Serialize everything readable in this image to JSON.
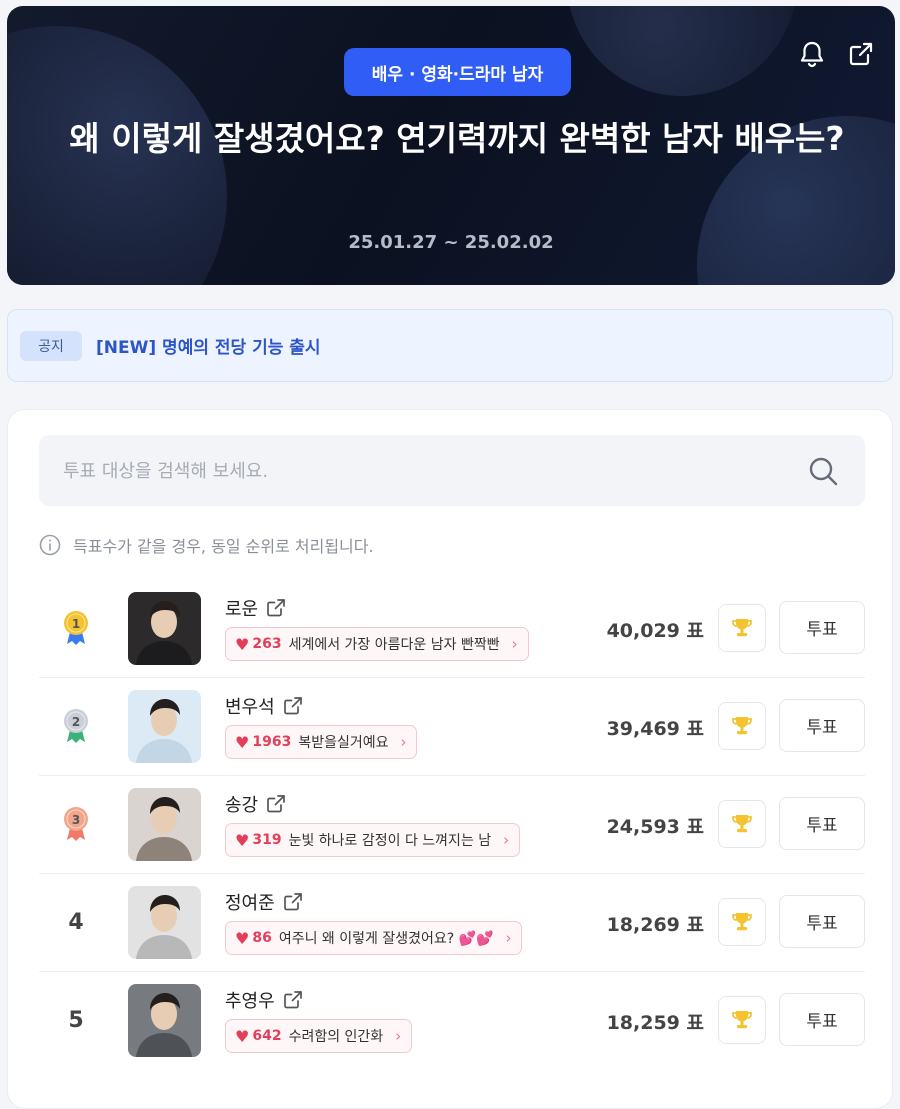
{
  "hero": {
    "category_badge": "배우 · 영화·드라마 남자",
    "title": "왜 이렇게 잘생겼어요? 연기력까지 완벽한 남자 배우는?",
    "period": "25.01.27 ~ 25.02.02",
    "icons": [
      "bell-icon",
      "share-icon"
    ]
  },
  "notice": {
    "tag": "공지",
    "text": "[NEW] 명예의 전당 기능 출시"
  },
  "search": {
    "placeholder": "투표 대상을 검색해 보세요.",
    "icon": "search-icon"
  },
  "info_text": "득표수가 같을 경우, 동일 순위로 처리됩니다.",
  "vote_label": "투표",
  "colors": {
    "accent": "#2f5df5",
    "heart": "#e43f5a",
    "gold": "#f5c330",
    "silver": "#c9ced8",
    "bronze": "#f2a58a"
  },
  "candidates": [
    {
      "rank": "1",
      "medal": "gold",
      "name": "로운",
      "cheer_count": "263",
      "cheer_text": "세계에서 가장 아름다운 남자 빤짝빤",
      "votes": "40,029 표"
    },
    {
      "rank": "2",
      "medal": "silver",
      "name": "변우석",
      "cheer_count": "1963",
      "cheer_text": "복받을실거예요",
      "votes": "39,469 표"
    },
    {
      "rank": "3",
      "medal": "bronze",
      "name": "송강",
      "cheer_count": "319",
      "cheer_text": "눈빛 하나로 감정이 다 느껴지는 남",
      "votes": "24,593 표"
    },
    {
      "rank": "4",
      "medal": "",
      "name": "정여준",
      "cheer_count": "86",
      "cheer_text": "여주니 왜 이렇게 잘생겼어요? 💕💕",
      "votes": "18,269 표"
    },
    {
      "rank": "5",
      "medal": "",
      "name": "추영우",
      "cheer_count": "642",
      "cheer_text": "수려함의 인간화",
      "votes": "18,259 표"
    }
  ]
}
